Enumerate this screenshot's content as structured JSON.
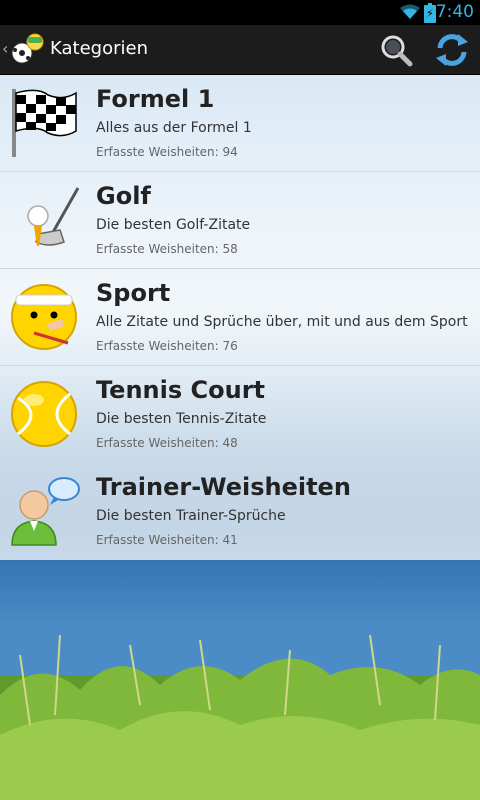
{
  "status_bar": {
    "time": "7:40",
    "battery_icon": "battery-charging-icon",
    "wifi_icon": "wifi-icon",
    "battery_glyph": "⚡"
  },
  "action_bar": {
    "title": "Kategorien",
    "up_glyph": "‹",
    "search_icon": "search-icon",
    "refresh_icon": "refresh-icon"
  },
  "categories": [
    {
      "name": "Formel 1",
      "description": "Alles aus der Formel 1",
      "count_label": "Erfasste Weisheiten: 94",
      "icon": "checkered-flag-icon"
    },
    {
      "name": "Golf",
      "description": "Die besten Golf-Zitate",
      "count_label": "Erfasste Weisheiten: 58",
      "icon": "golf-club-icon"
    },
    {
      "name": "Sport",
      "description": "Alle Zitate und Sprüche über, mit und aus dem Sport",
      "count_label": "Erfasste Weisheiten: 76",
      "icon": "injured-smiley-icon"
    },
    {
      "name": "Tennis Court",
      "description": "Die besten Tennis-Zitate",
      "count_label": "Erfasste Weisheiten: 48",
      "icon": "tennis-ball-icon"
    },
    {
      "name": "Trainer-Weisheiten",
      "description": "Die besten Trainer-Sprüche",
      "count_label": "Erfasste Weisheiten: 41",
      "icon": "trainer-speech-icon"
    }
  ]
}
